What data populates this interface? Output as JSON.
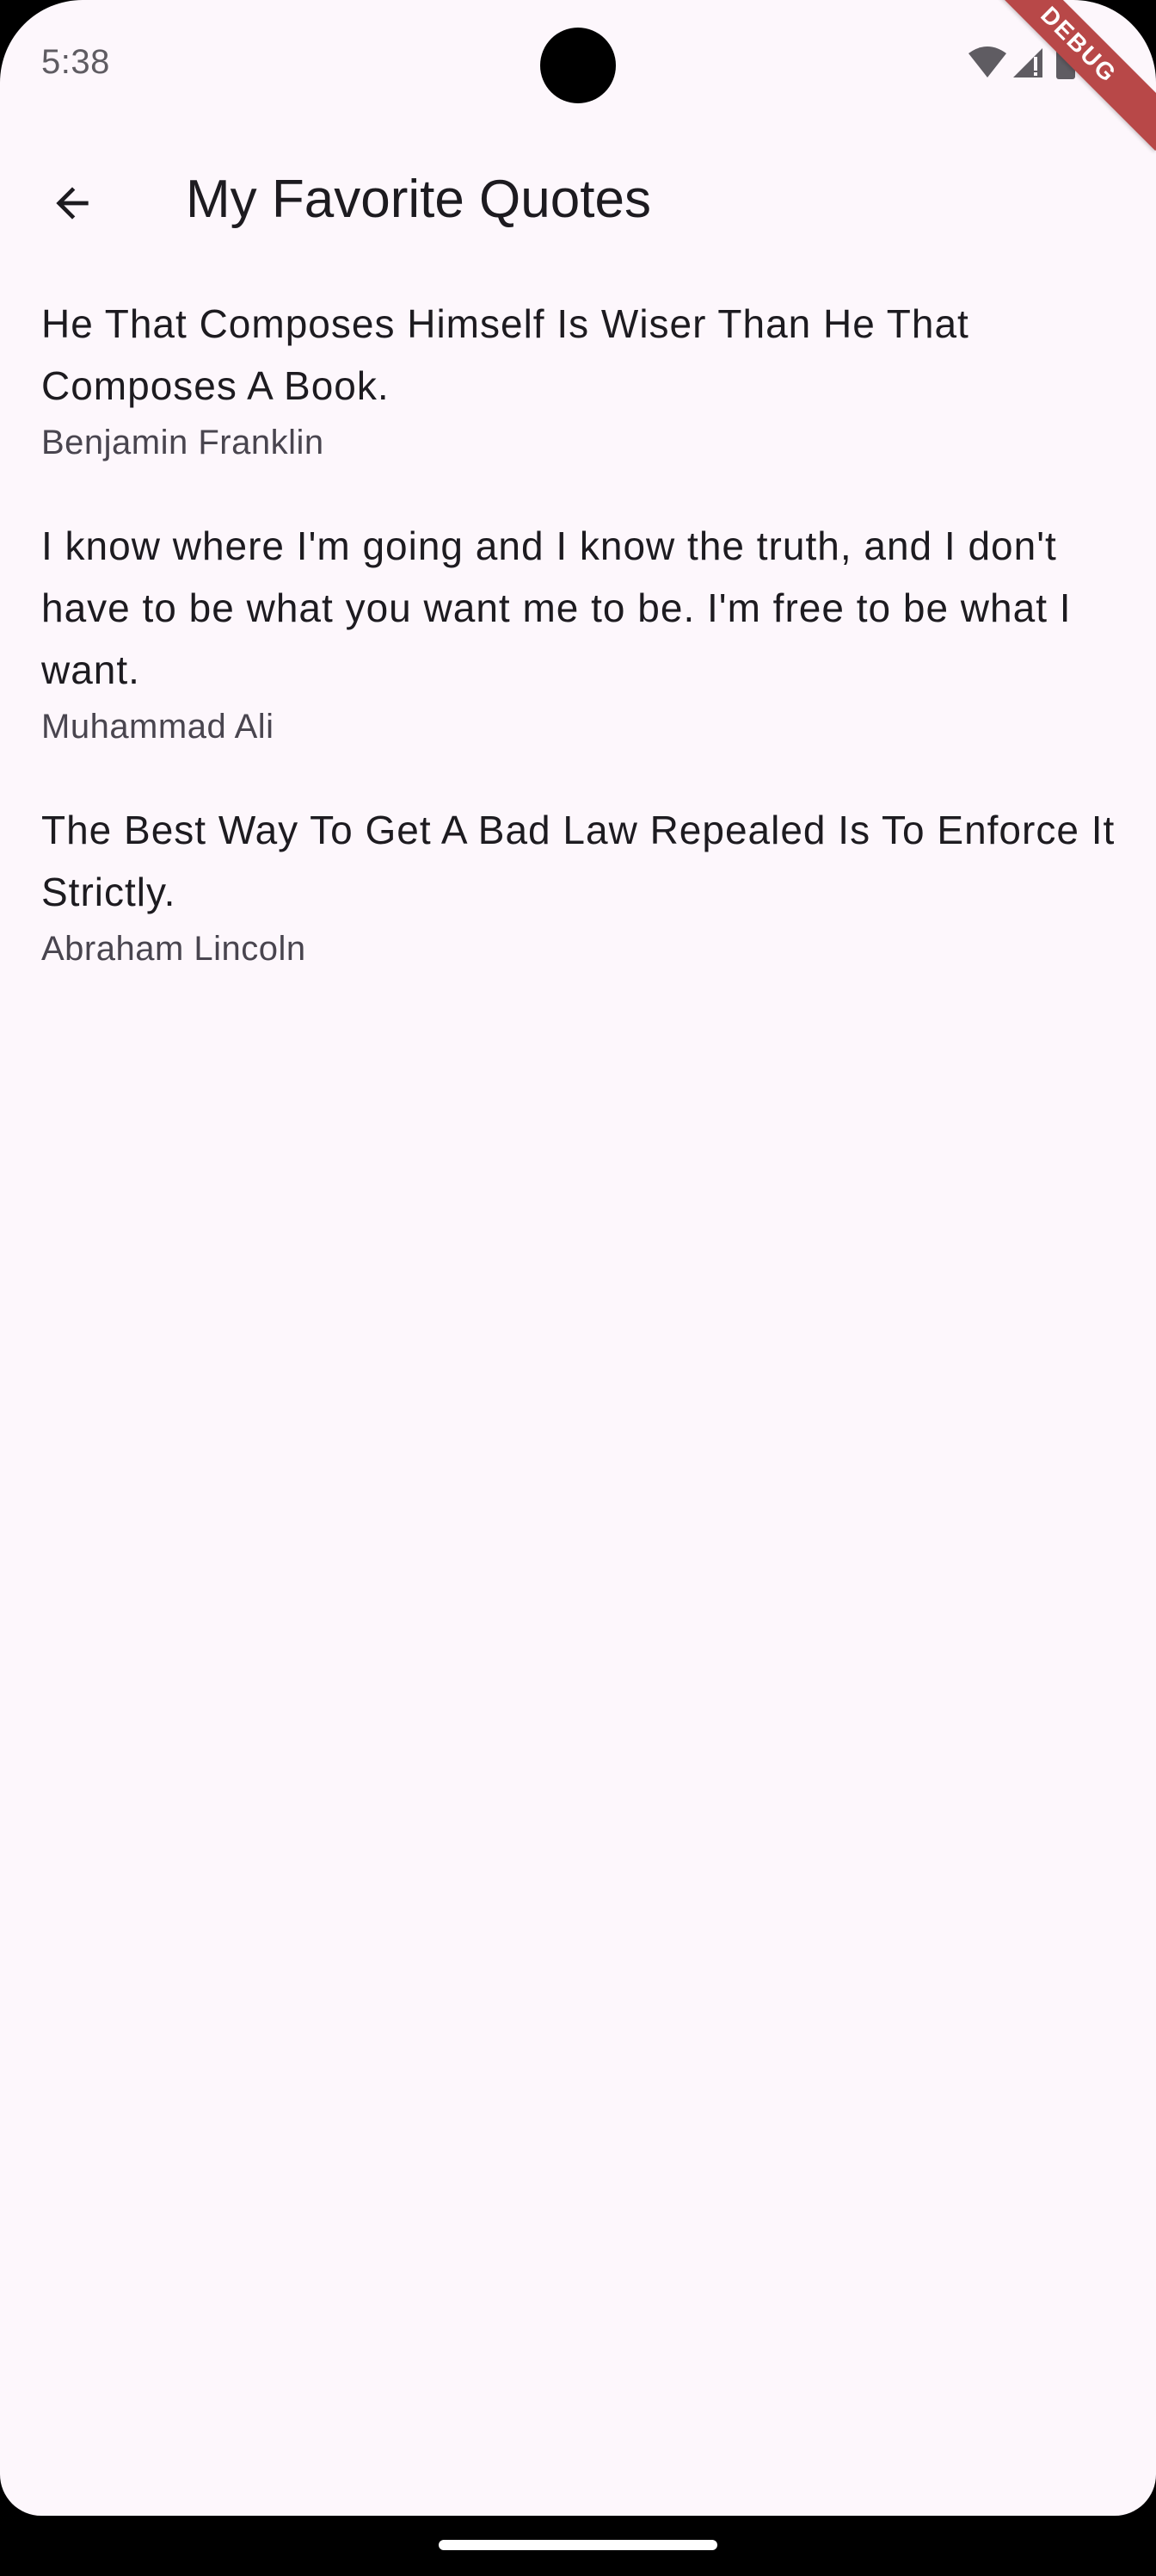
{
  "status_bar": {
    "time": "5:38"
  },
  "debug_banner": {
    "label": "DEBUG"
  },
  "app_bar": {
    "title": "My Favorite Quotes",
    "back_icon": "arrow-back-icon"
  },
  "quotes": [
    {
      "text": "He That Composes Himself Is Wiser Than He That Composes A Book.",
      "author": "Benjamin Franklin"
    },
    {
      "text": "I know where I'm going and I know the truth, and I don't have to be what you want me to be. I'm free to be what I want.",
      "author": "Muhammad Ali"
    },
    {
      "text": "The Best Way To Get A Bad Law Repealed Is To Enforce It Strictly.",
      "author": "Abraham Lincoln"
    }
  ],
  "colors": {
    "background": "#fdf7fc",
    "primary_text": "#1d1b20",
    "secondary_text": "#49454f",
    "debug_ribbon": "#b84848"
  }
}
